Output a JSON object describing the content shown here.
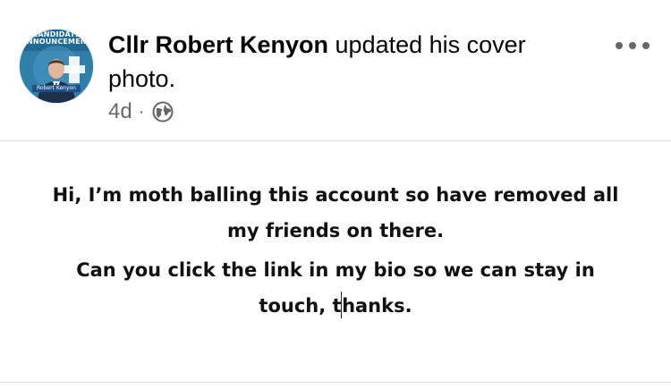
{
  "post": {
    "avatar": {
      "banner_text": "CANDIDATE\nANNOUNCEMENT",
      "name_tag": "Robert Kenyon",
      "bg_color": "#2f7fa8"
    },
    "author": "Cllr Robert Kenyon",
    "action": " updated his cover photo.",
    "time": "4d",
    "separator": "·",
    "audience_icon": "globe-icon",
    "more_icon": "more-horizontal-icon"
  },
  "cover": {
    "paragraph1_line1": "Hi, I’m moth balling this account so have removed all",
    "paragraph1_line2": "my friends on there.",
    "paragraph2_line1": "Can you click the link in my bio so we can stay in",
    "paragraph2_line2_before_caret": "touch, t",
    "paragraph2_line2_after_caret": "hanks."
  },
  "colors": {
    "text_primary": "#050505",
    "text_secondary": "#65676b",
    "divider": "#dcdde0"
  }
}
